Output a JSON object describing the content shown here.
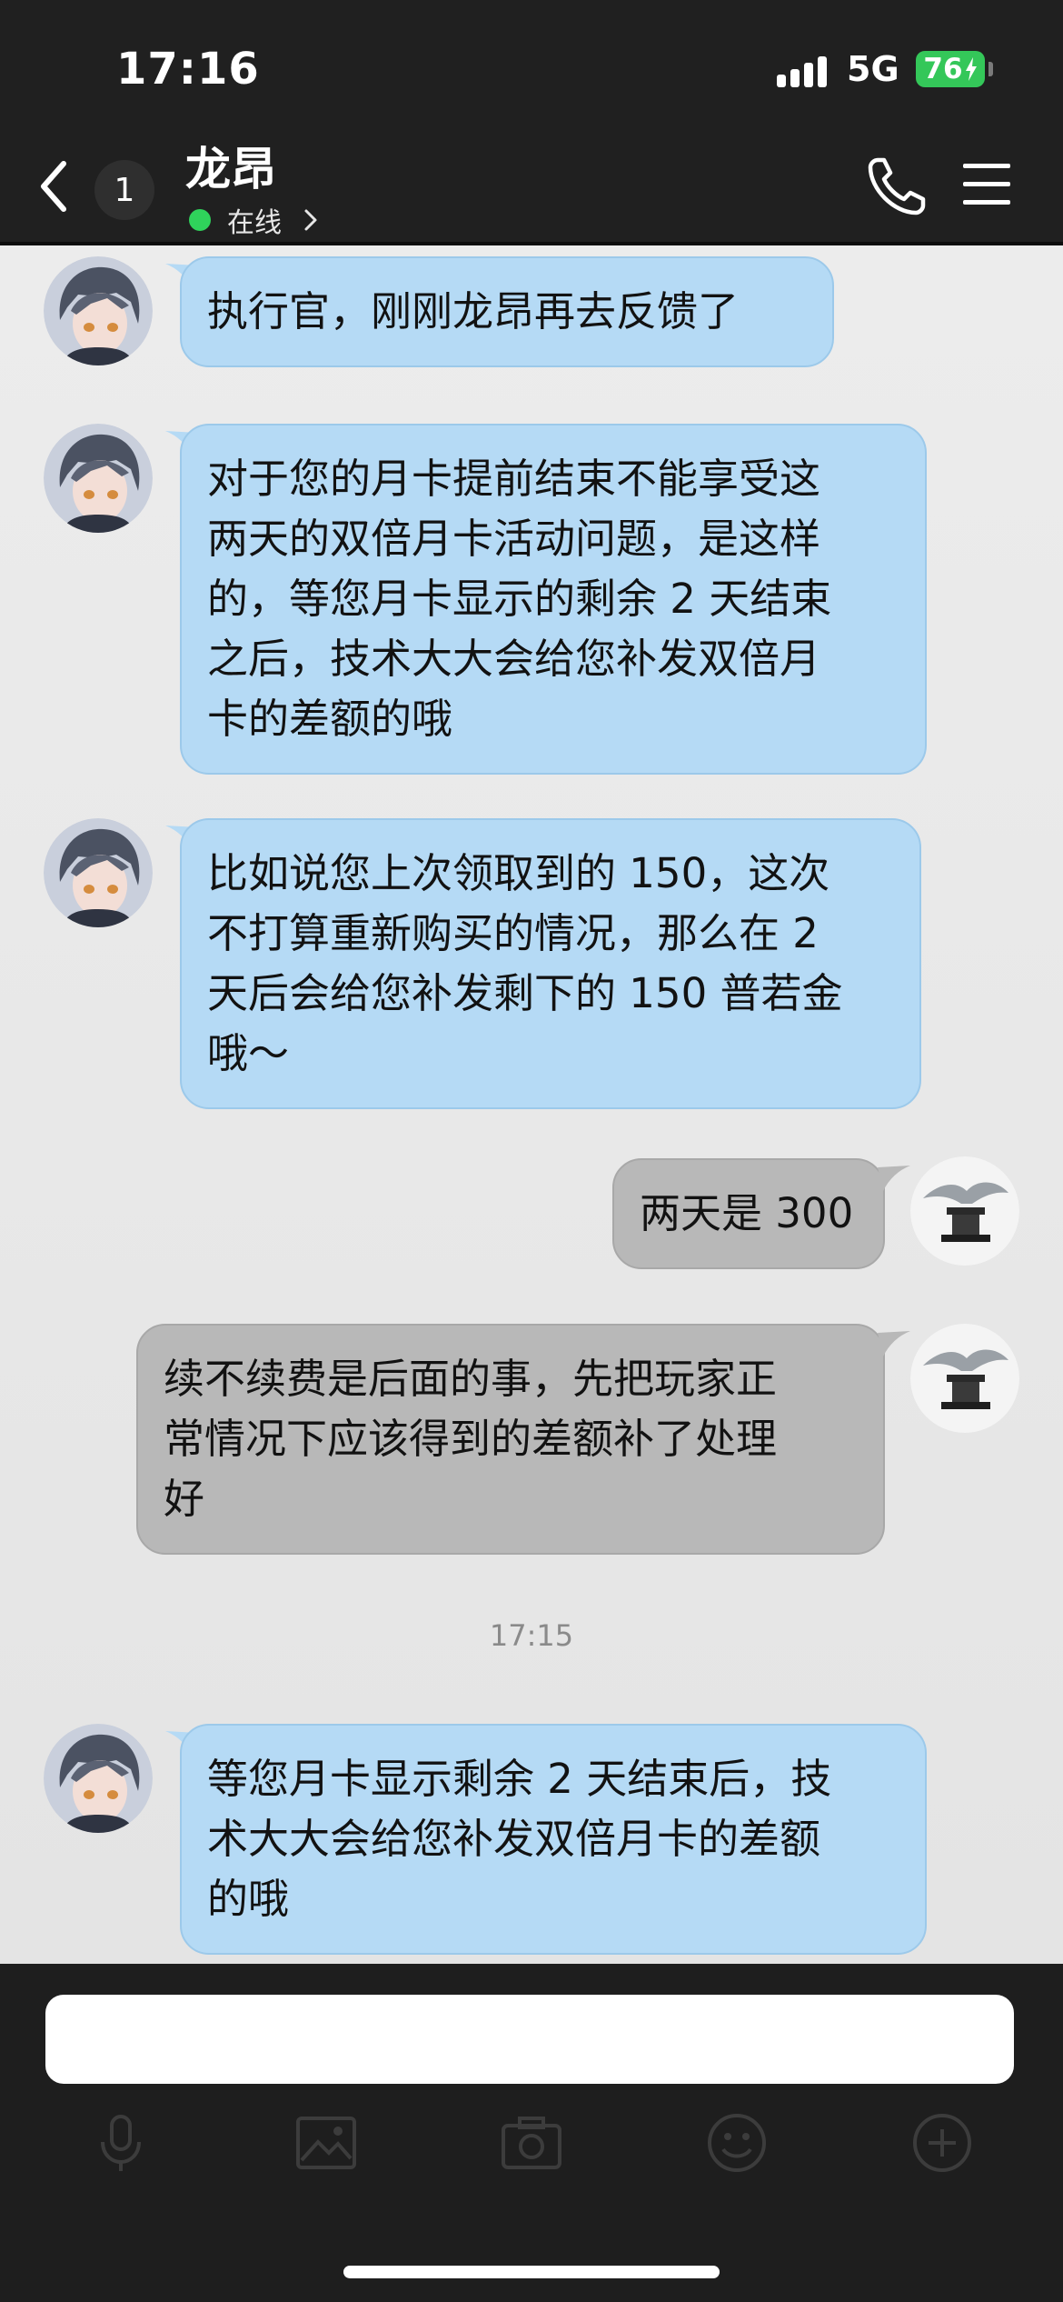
{
  "status_bar": {
    "time": "17:16",
    "network": "5G",
    "battery": "76"
  },
  "header": {
    "unread_count": "1",
    "contact_name": "龙昂",
    "presence": "在线"
  },
  "messages": [
    {
      "side": "incoming",
      "text": "执行官，刚刚龙昂再去反馈了"
    },
    {
      "side": "incoming",
      "text": "对于您的月卡提前结束不能享受这\n两天的双倍月卡活动问题，是这样\n的，等您月卡显示的剩余 2 天结束\n之后，技术大大会给您补发双倍月\n卡的差额的哦"
    },
    {
      "side": "incoming",
      "text": "比如说您上次领取到的 150，这次\n不打算重新购买的情况，那么在 2\n天后会给您补发剩下的 150 普若金\n哦～"
    },
    {
      "side": "outgoing",
      "text": "两天是 300"
    },
    {
      "side": "outgoing",
      "text": "续不续费是后面的事，先把玩家正\n常情况下应该得到的差额补了处理\n好"
    },
    {
      "side": "incoming",
      "text": "等您月卡显示剩余 2 天结束后，技\n术大大会给您补发双倍月卡的差额\n的哦"
    }
  ],
  "timestamp": "17:15",
  "composer": {
    "placeholder": "",
    "tools": [
      "microphone-icon",
      "image-icon",
      "camera-icon",
      "emoji-icon",
      "plus-icon"
    ]
  },
  "colors": {
    "header_bg": "#202020",
    "incoming_bubble": "#b5daf5",
    "outgoing_bubble": "#b8b8b8",
    "online_dot": "#2fd35b",
    "battery": "#34c759"
  }
}
